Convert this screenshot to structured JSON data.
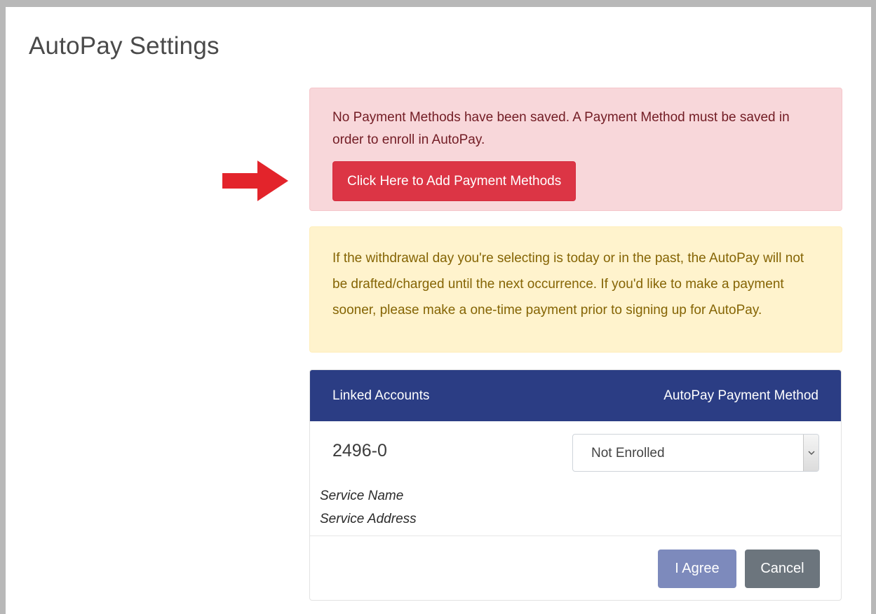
{
  "page": {
    "title": "AutoPay Settings"
  },
  "alert_danger": {
    "message": "No Payment Methods have been saved. A Payment Method must be saved in order to enroll in AutoPay.",
    "button_label": "Click Here to Add Payment Methods"
  },
  "alert_warning": {
    "message": "If the withdrawal day you're selecting is today or in the past, the AutoPay will not be drafted/charged until the next occurrence. If you'd like to make a payment sooner, please make a one-time payment prior to signing up for AutoPay."
  },
  "accounts_card": {
    "header_left": "Linked Accounts",
    "header_right": "AutoPay Payment Method",
    "rows": [
      {
        "account_number": "2496-0",
        "service_name": "Service Name",
        "service_address": "Service Address",
        "payment_method_selected": "Not Enrolled"
      }
    ],
    "agree_label": "I Agree",
    "cancel_label": "Cancel"
  },
  "colors": {
    "header_bg": "#2b3d84",
    "danger_bg": "#f8d7da",
    "danger_button": "#dc3545",
    "warning_bg": "#fff3cd",
    "agree_button": "#7d8abc",
    "cancel_button": "#6c757d",
    "arrow": "#e3242b"
  },
  "icons": {
    "arrow": "arrow-right-icon",
    "select_caret": "chevron-down-icon"
  }
}
